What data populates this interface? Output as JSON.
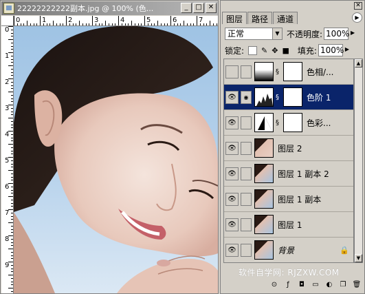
{
  "document": {
    "title": "22222222222副本.jpg @ 100% (色...",
    "buttons": [
      "_",
      "□",
      "✕"
    ],
    "ruler_top_numbers": [
      "0",
      "1",
      "2",
      "3",
      "4",
      "5",
      "6",
      "7"
    ],
    "ruler_left_numbers": [
      "0",
      "1",
      "2",
      "3",
      "4",
      "5",
      "6",
      "7",
      "8",
      "9"
    ]
  },
  "palette": {
    "tabs": [
      "图层",
      "路径",
      "通道"
    ],
    "blend_mode": "正常",
    "opacity_label": "不透明度:",
    "opacity_value": "100%",
    "lock_label": "锁定:",
    "fill_label": "填充:",
    "fill_value": "100%",
    "layers": [
      {
        "name": "色相/...",
        "visible": false,
        "type": "adjustment-hue"
      },
      {
        "name": "色阶 1",
        "visible": true,
        "type": "adjustment-levels",
        "selected": true
      },
      {
        "name": "色彩...",
        "visible": true,
        "type": "adjustment-color"
      },
      {
        "name": "图层 2",
        "visible": true,
        "type": "photo"
      },
      {
        "name": "图层 1 副本 2",
        "visible": true,
        "type": "photo"
      },
      {
        "name": "图层 1 副本",
        "visible": true,
        "type": "photo"
      },
      {
        "name": "图层 1",
        "visible": true,
        "type": "photo"
      },
      {
        "name": "背景",
        "visible": true,
        "type": "photo",
        "locked": true
      }
    ],
    "watermark": "软件自学网: RJZXW.COM",
    "bottom_icons": [
      "link-icon",
      "style-icon",
      "mask-icon",
      "folder-icon",
      "adjustment-icon",
      "new-layer-icon",
      "trash-icon"
    ]
  }
}
